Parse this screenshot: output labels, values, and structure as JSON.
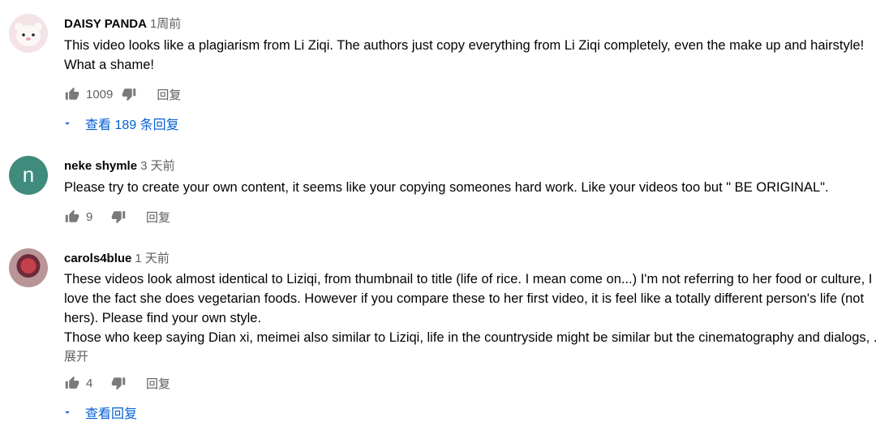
{
  "comments": [
    {
      "author": "DAISY PANDA",
      "time": "1周前",
      "lines": [
        "This video looks like a plagiarism from Li Ziqi. The authors just copy everything from Li Ziqi completely, even the make up and hairstyle!",
        "What a shame!"
      ],
      "likes": "1009",
      "reply_label": "回复",
      "replies_label": "查看 189 条回复"
    },
    {
      "author": "neke shymle",
      "time": "3 天前",
      "avatar_letter": "n",
      "lines": [
        "Please try to create your own content, it seems like your copying someones hard work. Like your videos too but \" BE ORIGINAL\"."
      ],
      "likes": "9",
      "reply_label": "回复"
    },
    {
      "author": "carols4blue",
      "time": "1 天前",
      "lines": [
        "These videos look almost identical to Liziqi, from thumbnail to title (life of rice. I mean come on...) I'm not referring to her food or culture, I",
        "love the fact she does vegetarian foods. However if you compare these to her first video, it is feel like a totally different person's life (not",
        "hers). Please find your own style.",
        "Those who keep saying Dian xi, meimei also similar to Liziqi, life in the countryside might be similar but the cinematography and dialogs, ..."
      ],
      "expand_label": "展开",
      "likes": "4",
      "reply_label": "回复",
      "replies_label": "查看回复"
    }
  ],
  "icons": {
    "like": "thumb-up-icon",
    "dislike": "thumb-down-icon",
    "expand": "caret-down-icon"
  },
  "colors": {
    "link": "#065fd4",
    "meta": "#606060",
    "avatar_n": "#3f8c7d"
  }
}
